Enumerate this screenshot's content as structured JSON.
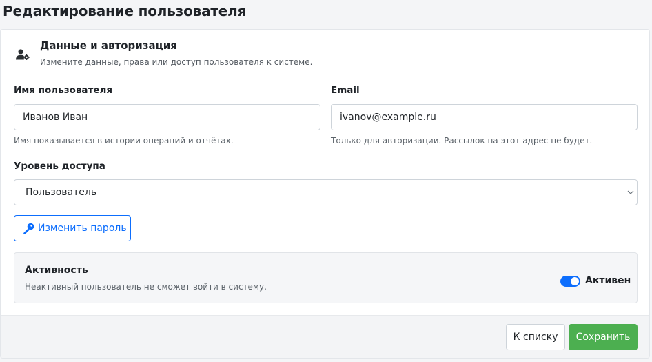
{
  "page": {
    "title": "Редактирование пользователя"
  },
  "section": {
    "icon": "user-gear-icon",
    "title": "Данные и авторизация",
    "subtitle": "Измените данные, права или доступ пользователя к системе."
  },
  "form": {
    "username": {
      "label": "Имя пользователя",
      "value": "Иванов Иван",
      "help": "Имя показывается в истории операций и отчётах."
    },
    "email": {
      "label": "Email",
      "value": "ivanov@example.ru",
      "help": "Только для авторизации. Рассылок на этот адрес не будет."
    },
    "access_level": {
      "label": "Уровень доступа",
      "selected": "Пользователь",
      "icon": "chevron-down-icon"
    },
    "change_password": {
      "label": "Изменить пароль",
      "icon": "key-icon"
    }
  },
  "activity": {
    "title": "Активность",
    "description": "Неактивный пользователь не сможет войти в систему.",
    "toggle_label": "Активен",
    "enabled": true
  },
  "footer": {
    "back_label": "К списку",
    "save_label": "Сохранить"
  },
  "colors": {
    "primary": "#0d6efd",
    "success": "#4caf50"
  }
}
